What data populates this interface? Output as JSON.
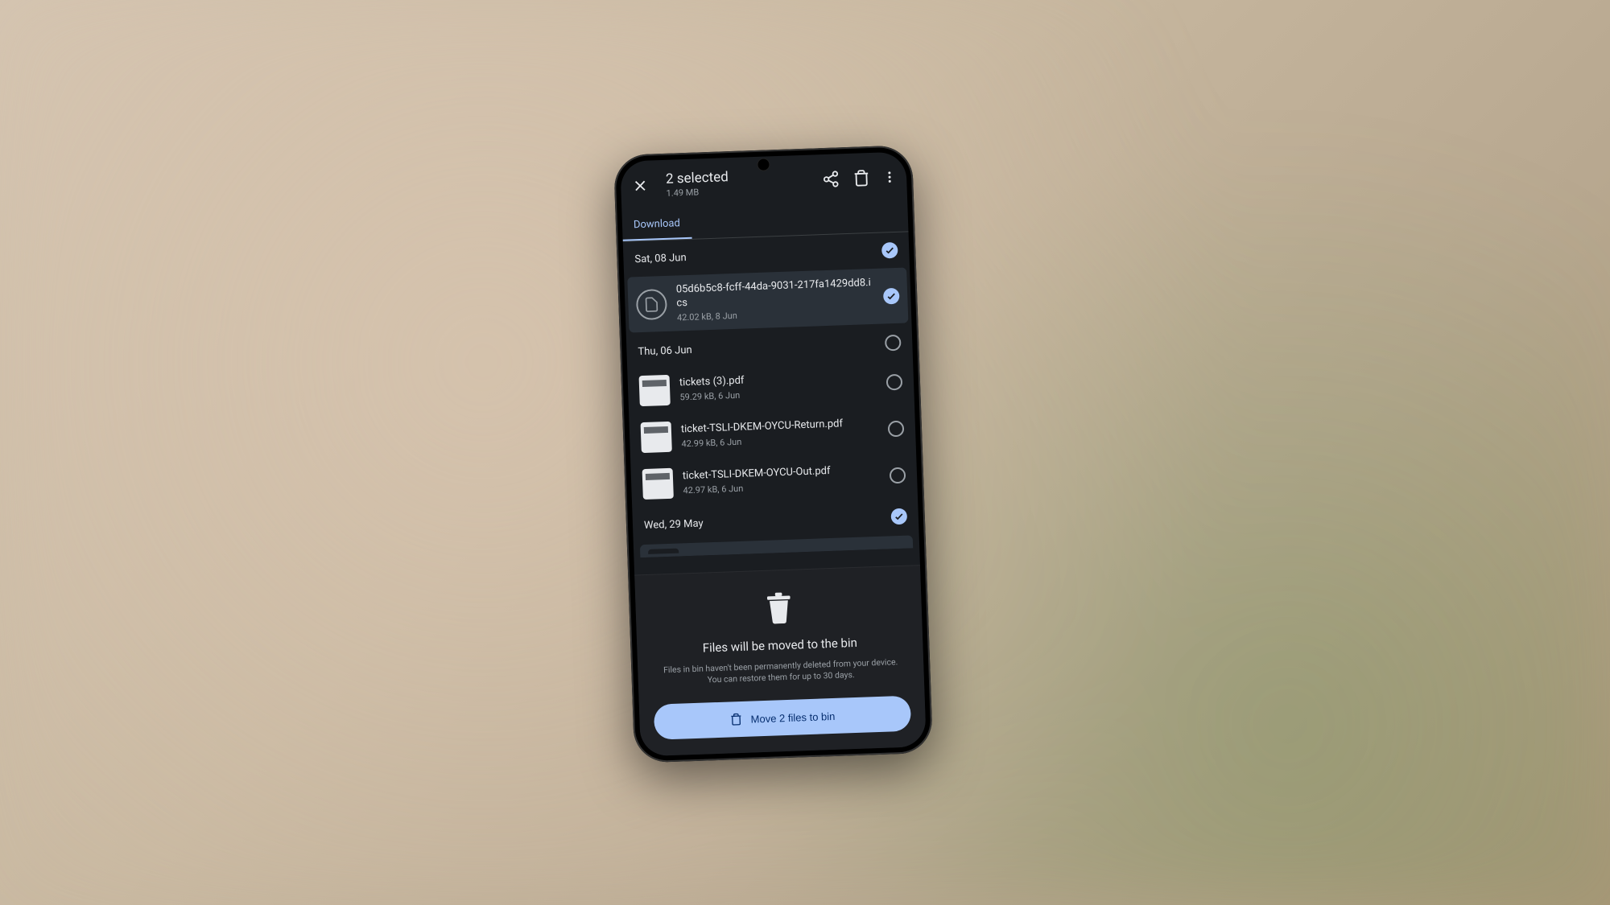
{
  "header": {
    "title": "2 selected",
    "subtitle": "1.49 MB"
  },
  "tab": {
    "label": "Download"
  },
  "groups": [
    {
      "date": "Sat, 08 Jun",
      "all_selected": true,
      "files": [
        {
          "name": "05d6b5c8-fcff-44da-9031-217fa1429dd8.ics",
          "meta": "42.02 kB, 8 Jun",
          "selected": true,
          "thumb": "file"
        }
      ]
    },
    {
      "date": "Thu, 06 Jun",
      "all_selected": false,
      "files": [
        {
          "name": "tickets (3).pdf",
          "meta": "59.29 kB, 6 Jun",
          "selected": false,
          "thumb": "pdf"
        },
        {
          "name": "ticket-TSLI-DKEM-OYCU-Return.pdf",
          "meta": "42.99 kB, 6 Jun",
          "selected": false,
          "thumb": "pdf"
        },
        {
          "name": "ticket-TSLI-DKEM-OYCU-Out.pdf",
          "meta": "42.97 kB, 6 Jun",
          "selected": false,
          "thumb": "pdf"
        }
      ]
    },
    {
      "date": "Wed, 29 May",
      "all_selected": true,
      "files": []
    }
  ],
  "sheet": {
    "title": "Files will be moved to the bin",
    "description": "Files in bin haven't been permanently deleted from your device. You can restore them for up to 30 days.",
    "button": "Move 2 files to bin"
  }
}
